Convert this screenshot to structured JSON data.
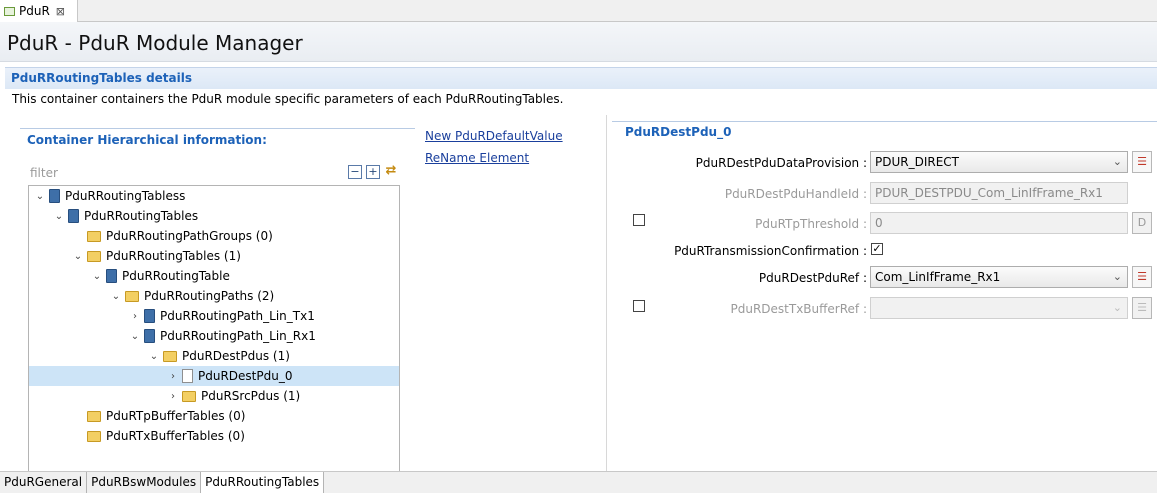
{
  "editor_tab": {
    "title": "PduR",
    "close": "⊠"
  },
  "page_title": "PduR - PduR Module Manager",
  "section": {
    "title": "PduRRoutingTables details",
    "description": "This container containers the PduR module specific parameters of each PduRRoutingTables."
  },
  "container": {
    "title": "Container Hierarchical information:",
    "filter_placeholder": "filter",
    "tools": [
      "−",
      "+",
      "⇄"
    ]
  },
  "tree": [
    {
      "twisty": "⌄",
      "icon": "book",
      "label": "PduRRoutingTabless"
    },
    {
      "twisty": "⌄",
      "icon": "book",
      "label": "PduRRoutingTables"
    },
    {
      "twisty": "",
      "icon": "folder",
      "label": "PduRRoutingPathGroups (0)"
    },
    {
      "twisty": "⌄",
      "icon": "folder",
      "label": "PduRRoutingTables (1)"
    },
    {
      "twisty": "⌄",
      "icon": "book",
      "label": "PduRRoutingTable"
    },
    {
      "twisty": "⌄",
      "icon": "folder",
      "label": "PduRRoutingPaths (2)"
    },
    {
      "twisty": "›",
      "icon": "book",
      "label": "PduRRoutingPath_Lin_Tx1"
    },
    {
      "twisty": "⌄",
      "icon": "book",
      "label": "PduRRoutingPath_Lin_Rx1"
    },
    {
      "twisty": "⌄",
      "icon": "folder",
      "label": "PduRDestPdus (1)"
    },
    {
      "twisty": "›",
      "icon": "doc",
      "label": "PduRDestPdu_0"
    },
    {
      "twisty": "›",
      "icon": "folder",
      "label": "PduRSrcPdus (1)"
    },
    {
      "twisty": "",
      "icon": "folder",
      "label": "PduRTpBufferTables (0)"
    },
    {
      "twisty": "",
      "icon": "folder",
      "label": "PduRTxBufferTables (0)"
    }
  ],
  "links": {
    "new_default": "New PduRDefaultValue",
    "rename": "ReName Element"
  },
  "dest": {
    "title": "PduRDestPdu_0",
    "data_provision_label": "PduRDestPduDataProvision :",
    "data_provision_value": "PDUR_DIRECT",
    "handle_id_label": "PduRDestPduHandleId :",
    "handle_id_value": "PDUR_DESTPDU_Com_LinIfFrame_Rx1",
    "tp_threshold_label": "PduRTpThreshold :",
    "tp_threshold_value": "0",
    "tp_threshold_btn": "D",
    "tx_confirm_label": "PduRTransmissionConfirmation :",
    "tx_confirm_check": "✓",
    "dest_ref_label": "PduRDestPduRef :",
    "dest_ref_value": "Com_LinIfFrame_Rx1",
    "tx_buffer_ref_label": "PduRDestTxBufferRef :",
    "tx_buffer_ref_value": "",
    "list_icon": "☰",
    "caret": "⌄"
  },
  "bottom_tabs": [
    "PduRGeneral",
    "PduRBswModules",
    "PduRRoutingTables"
  ]
}
